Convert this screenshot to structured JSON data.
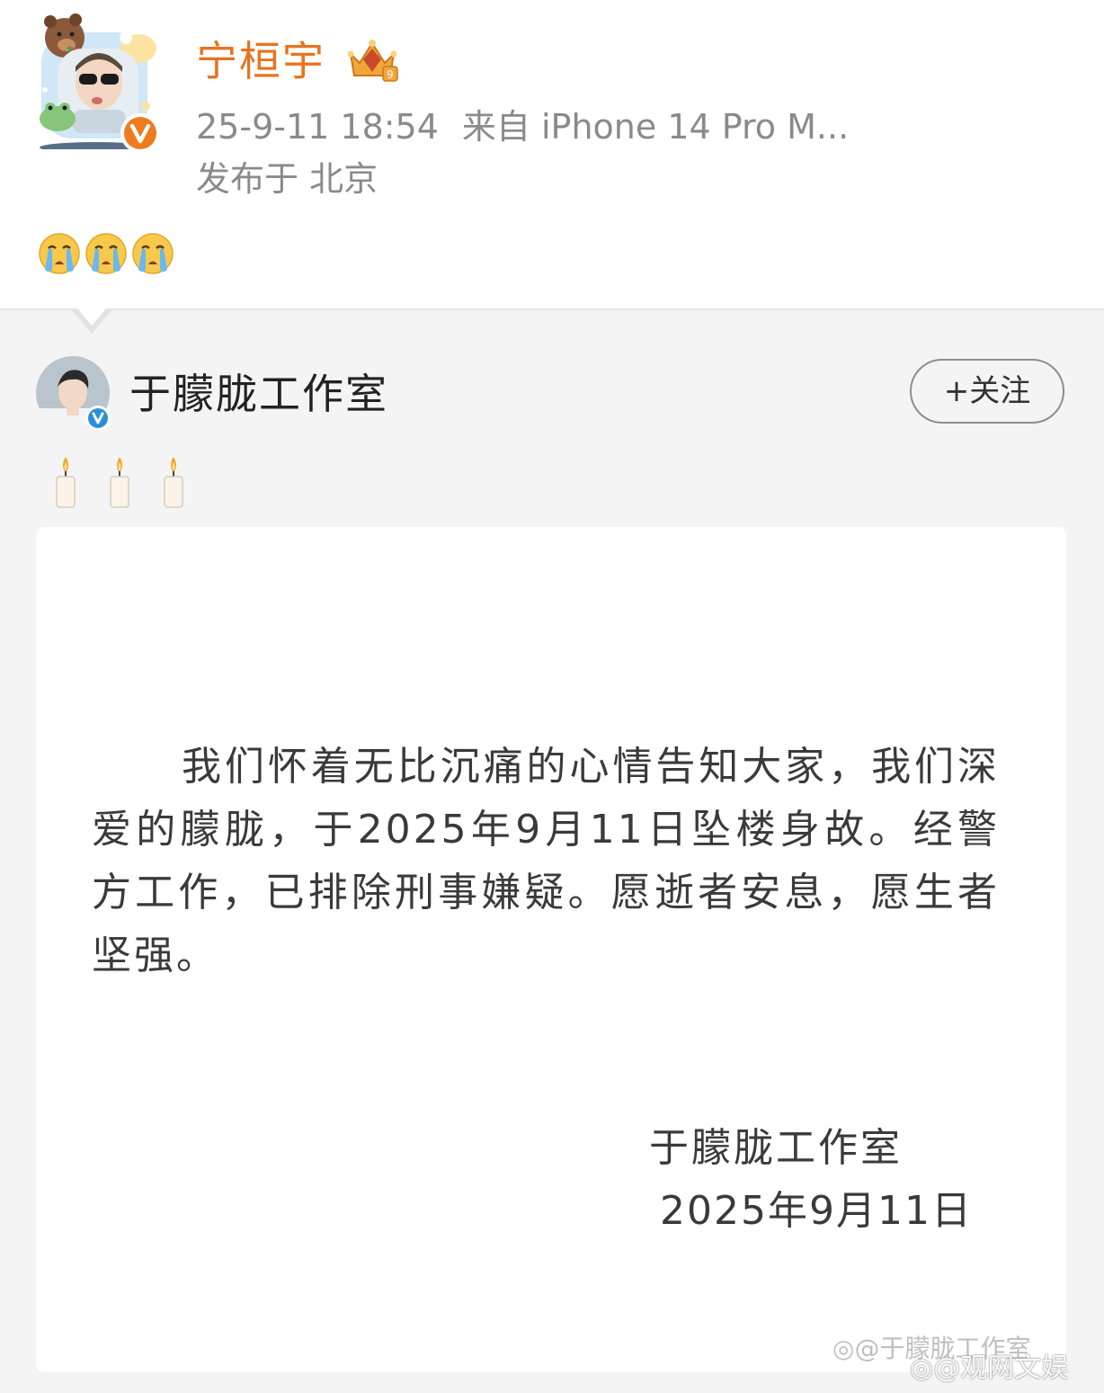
{
  "post": {
    "author_name": "宁桓宇",
    "timestamp": "25-9-11 18:54",
    "source": "来自 iPhone 14 Pro M...",
    "location": "发布于 北京",
    "emojis": [
      "crying-face-emoji",
      "crying-face-emoji",
      "crying-face-emoji"
    ]
  },
  "repost": {
    "author_name": "于朦胧工作室",
    "follow_label": "+关注",
    "emojis": [
      "candle-emoji",
      "candle-emoji",
      "candle-emoji"
    ],
    "statement": {
      "body": "我们怀着无比沉痛的心情告知大家，我们深爱的朦胧，于2025年9月11日坠楼身故。经警方工作，已排除刑事嫌疑。愿逝者安息，愿生者坚强。",
      "signature": "于朦胧工作室",
      "date": "2025年9月11日"
    }
  },
  "watermark": {
    "line1": "@于朦胧工作室",
    "line2": "@观网文娱"
  },
  "colors": {
    "author_accent": "#e8731e",
    "verified_orange": "#f07a1e",
    "verified_blue": "#2a8fd8",
    "meta_gray": "#8a8a8a",
    "repost_bg": "#f4f4f4"
  }
}
